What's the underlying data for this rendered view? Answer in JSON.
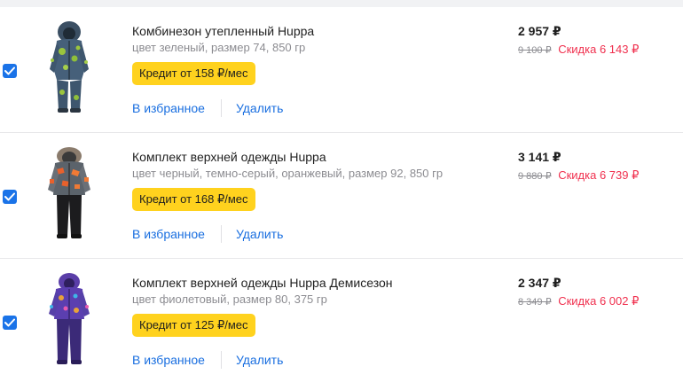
{
  "items": [
    {
      "title": "Комбинезон утепленный Huppa",
      "specs": "цвет зеленый, размер 74, 850 гр",
      "credit": "Кредит от 158 ₽/мес",
      "favorite": "В избранное",
      "remove": "Удалить",
      "price": "2 957 ₽",
      "old_price": "9 100 ₽",
      "discount": "Скидка 6 143 ₽",
      "checked": true,
      "image": "green-camo-snowsuit"
    },
    {
      "title": "Комплект верхней одежды Huppa",
      "specs": "цвет черный, темно-серый, оранжевый, размер 92, 850 гр",
      "credit": "Кредит от 168 ₽/мес",
      "favorite": "В избранное",
      "remove": "Удалить",
      "price": "3 141 ₽",
      "old_price": "9 880 ₽",
      "discount": "Скидка 6 739 ₽",
      "checked": true,
      "image": "orange-grey-jacket-black-pants"
    },
    {
      "title": "Комплект верхней одежды Huppa Демисезон",
      "specs": "цвет фиолетовый, размер 80, 375 гр",
      "credit": "Кредит от 125 ₽/мес",
      "favorite": "В избранное",
      "remove": "Удалить",
      "price": "2 347 ₽",
      "old_price": "8 349 ₽",
      "discount": "Скидка 6 002 ₽",
      "checked": true,
      "image": "purple-jacket-purple-pants"
    }
  ],
  "colors": {
    "checkbox": "#1a73e8",
    "credit_badge": "#ffd21e",
    "link": "#1a6fe0",
    "discount": "#f0314f",
    "muted": "#8c8c91"
  }
}
